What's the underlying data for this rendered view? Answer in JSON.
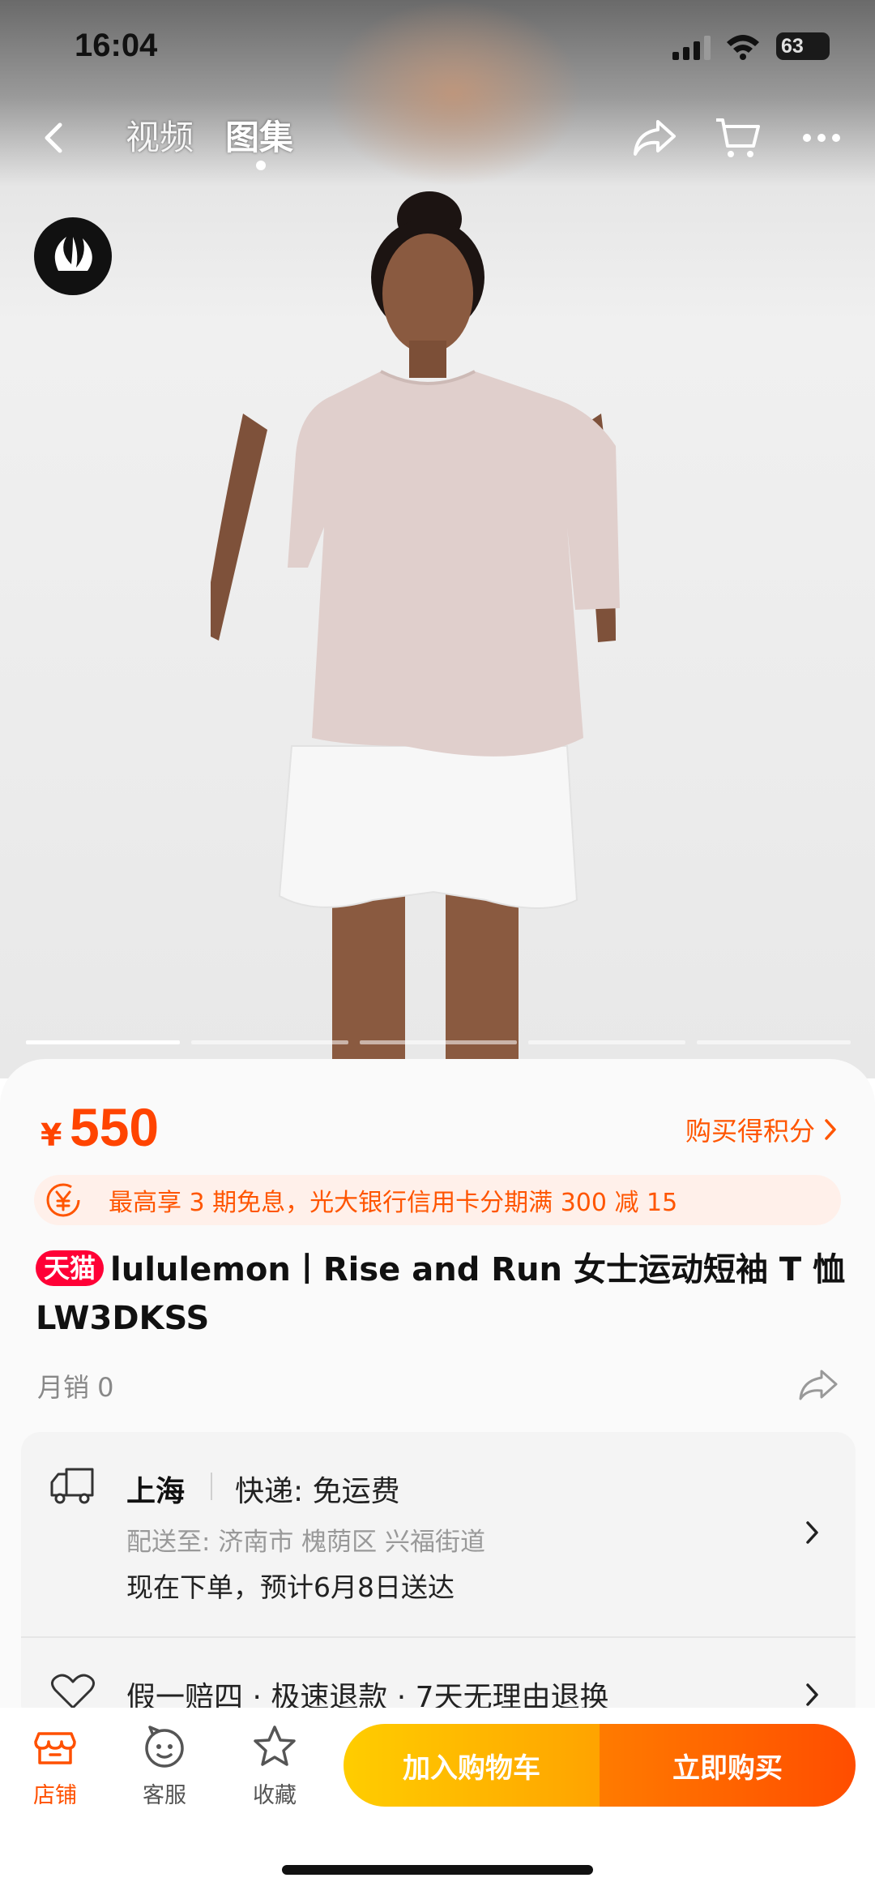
{
  "status_bar": {
    "time": "16:04",
    "battery": "63"
  },
  "top_nav": {
    "tabs": [
      "视频",
      "图集"
    ],
    "active_tab": 1
  },
  "gallery": {
    "brand_logo": "lululemon-logo",
    "page_count": 5,
    "active_page": 0
  },
  "product": {
    "price_currency": "¥",
    "price": "550",
    "points_link": "购买得积分",
    "promo_text": "最高享 3 期免息，光大银行信用卡分期满 300 减 15",
    "store_badge": "天猫",
    "title": "lululemon丨Rise and Run 女士运动短袖 T 恤 LW3DKSS",
    "monthly_sales": "月销 0"
  },
  "shipping": {
    "from_city": "上海",
    "express": "快递: 免运费",
    "deliver_to": "配送至: 济南市 槐荫区 兴福街道",
    "eta": "现在下单，预计6月8日送达"
  },
  "guarantee": {
    "text": "假一赔四 · 极速退款 · 7天无理由退换"
  },
  "bottom_bar": {
    "items": [
      {
        "label": "店铺",
        "icon": "store-icon"
      },
      {
        "label": "客服",
        "icon": "customer-service-icon"
      },
      {
        "label": "收藏",
        "icon": "star-icon"
      }
    ],
    "add_to_cart": "加入购物车",
    "buy_now": "立即购买"
  },
  "colors": {
    "accent": "#ff5000",
    "price": "#ff4400",
    "tmall": "#ff0036",
    "cart_btn": "#ffb800",
    "buy_btn": "#ff5a00"
  }
}
